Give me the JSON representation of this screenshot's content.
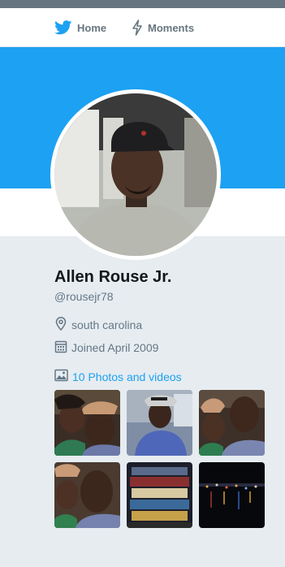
{
  "colors": {
    "banner": "#1da1f2",
    "link": "#1da1f2",
    "muted": "#657786",
    "background": "#e6ecf0"
  },
  "nav": {
    "items": [
      {
        "label": "Home",
        "icon": "twitter-bird-icon"
      },
      {
        "label": "Moments",
        "icon": "lightning-icon"
      }
    ]
  },
  "profile": {
    "name": "Allen Rouse Jr.",
    "handle": "@rousejr78",
    "location": "south carolina",
    "location_icon": "location-pin-icon",
    "joined": "Joined April 2009",
    "joined_icon": "calendar-icon"
  },
  "media": {
    "link_label": "10 Photos and videos",
    "link_icon": "photo-icon",
    "thumbnails": [
      {
        "description": "selfie-pair"
      },
      {
        "description": "man-in-cap"
      },
      {
        "description": "selfie-pair"
      },
      {
        "description": "selfie-pair"
      },
      {
        "description": "bottles-display"
      },
      {
        "description": "night-city"
      }
    ]
  }
}
